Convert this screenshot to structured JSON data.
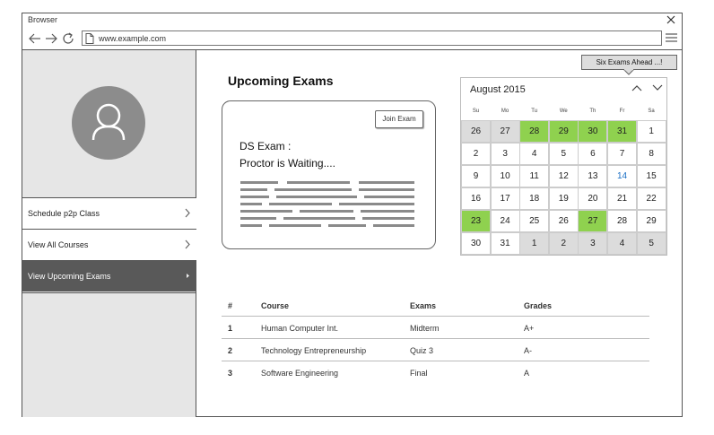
{
  "browser": {
    "title": "Browser",
    "url": "www.example.com"
  },
  "sidebar": {
    "items": [
      {
        "label": "Schedule p2p Class",
        "active": false
      },
      {
        "label": "View All Courses",
        "active": false
      },
      {
        "label": "View Upcoming Exams",
        "active": true
      }
    ]
  },
  "main": {
    "title": "Upcoming Exams",
    "card": {
      "join_label": "Join Exam",
      "line1": "DS Exam :",
      "line2": "Proctor is Waiting...."
    },
    "tooltip": "Six Exams Ahead ...!"
  },
  "calendar": {
    "month": "August 2015",
    "weekdays": [
      "Su",
      "Mo",
      "Tu",
      "We",
      "Th",
      "Fr",
      "Sa"
    ],
    "weeks": [
      [
        {
          "d": "26",
          "s": "out"
        },
        {
          "d": "27",
          "s": "out"
        },
        {
          "d": "28",
          "s": "exam"
        },
        {
          "d": "29",
          "s": "exam"
        },
        {
          "d": "30",
          "s": "exam"
        },
        {
          "d": "31",
          "s": "exam"
        },
        {
          "d": "1",
          "s": ""
        }
      ],
      [
        {
          "d": "2",
          "s": ""
        },
        {
          "d": "3",
          "s": ""
        },
        {
          "d": "4",
          "s": ""
        },
        {
          "d": "5",
          "s": ""
        },
        {
          "d": "6",
          "s": ""
        },
        {
          "d": "7",
          "s": ""
        },
        {
          "d": "8",
          "s": ""
        }
      ],
      [
        {
          "d": "9",
          "s": ""
        },
        {
          "d": "10",
          "s": ""
        },
        {
          "d": "11",
          "s": ""
        },
        {
          "d": "12",
          "s": ""
        },
        {
          "d": "13",
          "s": ""
        },
        {
          "d": "14",
          "s": "today"
        },
        {
          "d": "15",
          "s": ""
        }
      ],
      [
        {
          "d": "16",
          "s": ""
        },
        {
          "d": "17",
          "s": ""
        },
        {
          "d": "18",
          "s": ""
        },
        {
          "d": "19",
          "s": ""
        },
        {
          "d": "20",
          "s": ""
        },
        {
          "d": "21",
          "s": ""
        },
        {
          "d": "22",
          "s": ""
        }
      ],
      [
        {
          "d": "23",
          "s": "exam"
        },
        {
          "d": "24",
          "s": ""
        },
        {
          "d": "25",
          "s": ""
        },
        {
          "d": "26",
          "s": ""
        },
        {
          "d": "27",
          "s": "exam"
        },
        {
          "d": "28",
          "s": ""
        },
        {
          "d": "29",
          "s": ""
        }
      ],
      [
        {
          "d": "30",
          "s": ""
        },
        {
          "d": "31",
          "s": ""
        },
        {
          "d": "1",
          "s": "out"
        },
        {
          "d": "2",
          "s": "out"
        },
        {
          "d": "3",
          "s": "out"
        },
        {
          "d": "4",
          "s": "out"
        },
        {
          "d": "5",
          "s": "out"
        }
      ]
    ]
  },
  "table": {
    "headers": [
      "#",
      "Course",
      "Exams",
      "Grades"
    ],
    "rows": [
      [
        "1",
        "Human Computer Int.",
        "Midterm",
        "A+"
      ],
      [
        "2",
        "Technology Entrepreneurship",
        "Quiz 3",
        "A-"
      ],
      [
        "3",
        "Software Engineering",
        "Final",
        "A"
      ]
    ]
  },
  "colors": {
    "exam_day": "#8fd14f",
    "today_text": "#1a6fc4",
    "active_nav": "#595959",
    "sidebar_bg": "#e6e6e6"
  }
}
